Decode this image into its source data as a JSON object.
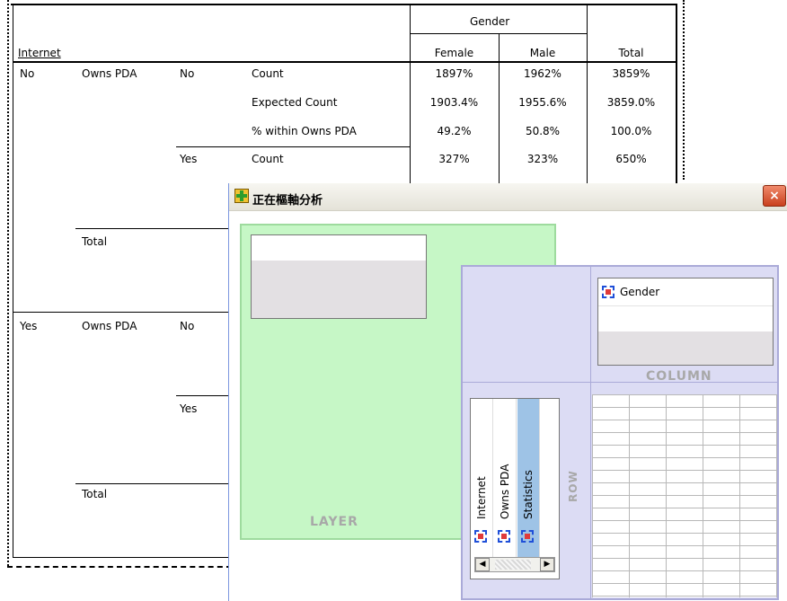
{
  "table": {
    "header_group": "Gender",
    "row_var_title": "Internet",
    "col_headers": [
      "Female",
      "Male",
      "Total"
    ],
    "internet": [
      "No",
      "Yes"
    ],
    "owns_pda_label": "Owns PDA",
    "sub_no": "No",
    "sub_yes": "Yes",
    "total_label": "Total",
    "stats": [
      "Count",
      "Expected Count",
      "% within Owns PDA"
    ],
    "rows": [
      [
        "1897%",
        "1962%",
        "3859%"
      ],
      [
        "1903.4%",
        "1955.6%",
        "3859.0%"
      ],
      [
        "49.2%",
        "50.8%",
        "100.0%"
      ],
      [
        "327%",
        "323%",
        "650%"
      ]
    ]
  },
  "dialog": {
    "title": "正在樞軸分析",
    "close_glyph": "×",
    "layer_label": "LAYER",
    "column_label": "COLUMN",
    "row_label": "ROW",
    "column_items": [
      "Gender"
    ],
    "row_items": [
      "Internet",
      "Owns PDA",
      "Statistics"
    ],
    "selected_row_item": "Statistics",
    "icons": [
      "pivot-variable-icon",
      "pivot-title-icon"
    ]
  }
}
